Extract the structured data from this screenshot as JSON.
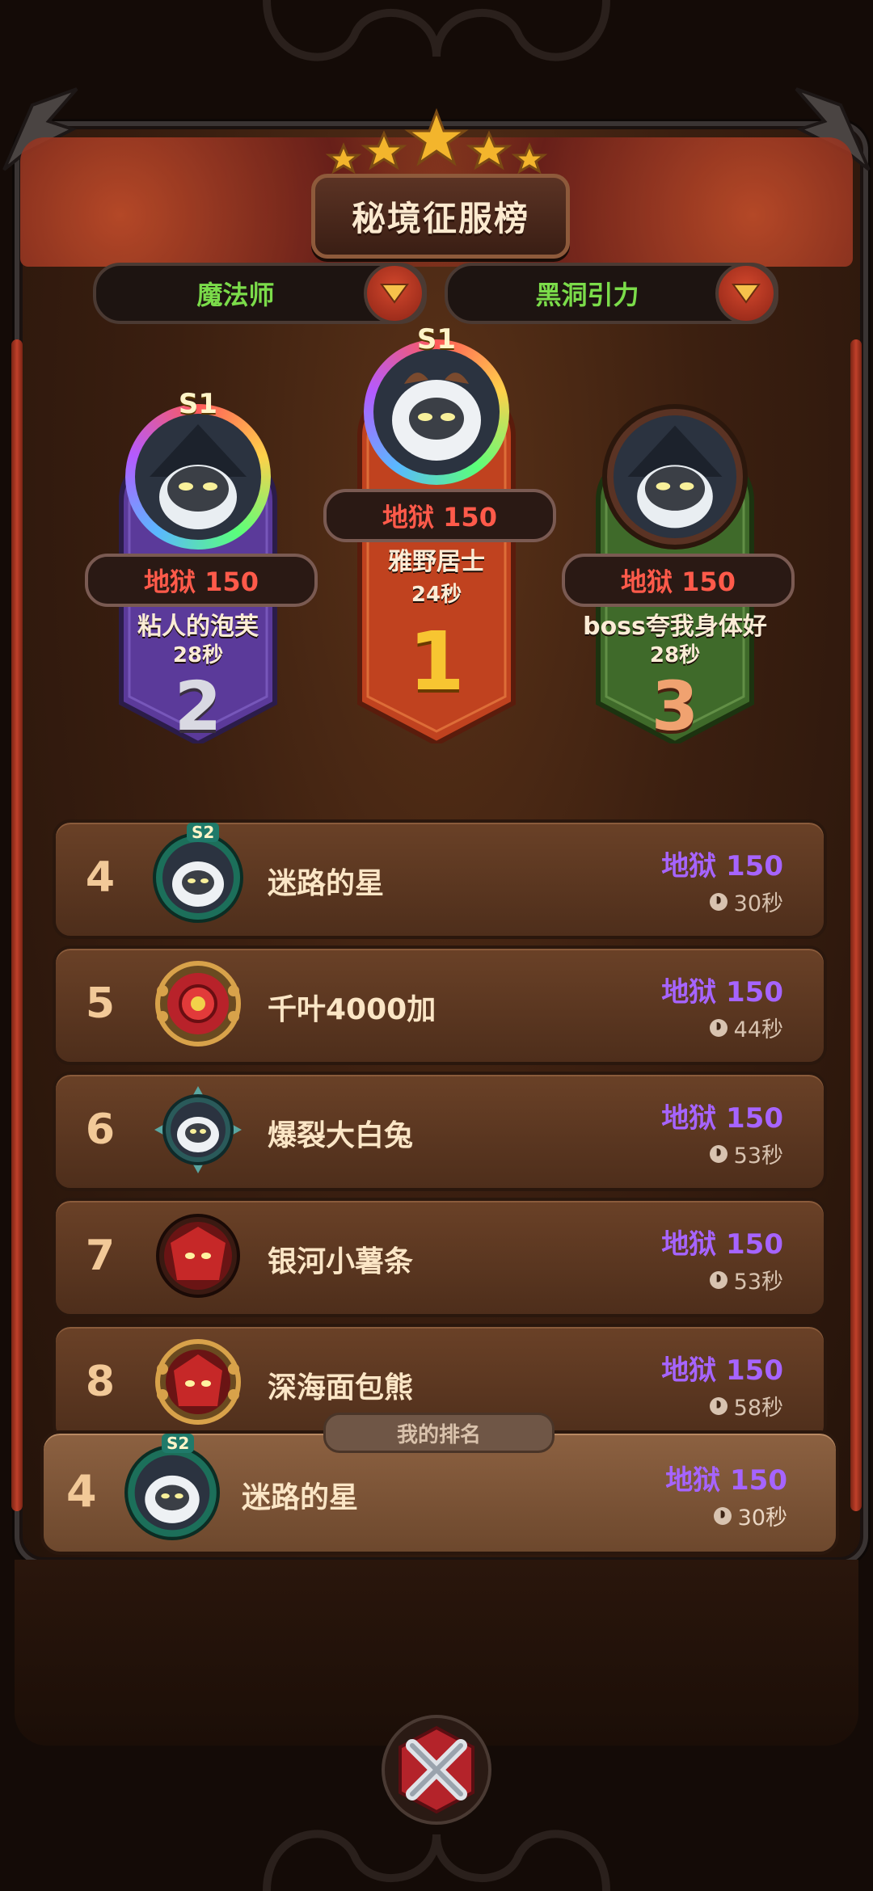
{
  "title": "秘境征服榜",
  "filters": {
    "class": "魔法师",
    "mode": "黑洞引力"
  },
  "podium": [
    {
      "rank": "2",
      "season": "S1",
      "difficulty": "地狱 150",
      "name": "粘人的泡芙",
      "time": "28秒"
    },
    {
      "rank": "1",
      "season": "S1",
      "difficulty": "地狱 150",
      "name": "雅野居士",
      "time": "24秒"
    },
    {
      "rank": "3",
      "season": "",
      "difficulty": "地狱 150",
      "name": "boss夸我身体好",
      "time": "28秒"
    }
  ],
  "list": [
    {
      "rank": "4",
      "season": "S2",
      "name": "迷路的星",
      "difficulty": "地狱 150",
      "time": "30秒"
    },
    {
      "rank": "5",
      "season": "",
      "name": "千叶4000加",
      "difficulty": "地狱 150",
      "time": "44秒"
    },
    {
      "rank": "6",
      "season": "",
      "name": "爆裂大白兔",
      "difficulty": "地狱 150",
      "time": "53秒"
    },
    {
      "rank": "7",
      "season": "",
      "name": "银河小薯条",
      "difficulty": "地狱 150",
      "time": "53秒"
    },
    {
      "rank": "8",
      "season": "",
      "name": "深海面包熊",
      "difficulty": "地狱 150",
      "time": "58秒"
    }
  ],
  "my_rank": {
    "tag": "我的排名",
    "rank": "4",
    "season": "S2",
    "name": "迷路的星",
    "difficulty": "地狱 150",
    "time": "30秒"
  },
  "icons": {
    "close": "close-x-icon",
    "dropdown": "chevron-down-icon",
    "clock": "clock-icon",
    "stars": "star-icon"
  },
  "colors": {
    "difficulty_red": "#ff5a4a",
    "difficulty_purple": "#a664ff",
    "filter_green": "#7bdc4a",
    "gold": "#f7c531",
    "silver": "#d9d9e2",
    "bronze": "#f0a270"
  }
}
